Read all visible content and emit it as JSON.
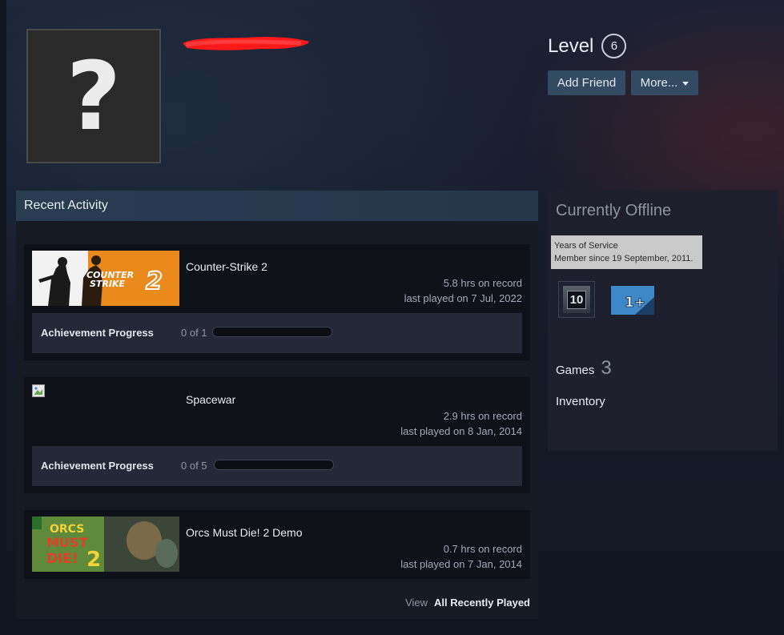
{
  "profile": {
    "avatar_placeholder": "?",
    "level_label": "Level",
    "level_value": "6",
    "add_friend_label": "Add Friend",
    "more_label": "More...",
    "colors": {
      "button": "#334a63",
      "redaction": "#ff0000"
    }
  },
  "recent_activity": {
    "title": "Recent Activity",
    "games": [
      {
        "name": "Counter-Strike 2",
        "capsule_text": [
          "COUNTER",
          "STRIKE"
        ],
        "hours": "5.8 hrs on record",
        "last_played": "last played on 7 Jul, 2022",
        "achievement_label": "Achievement Progress",
        "achievement_count": "0 of 1",
        "achievement_progress": 0
      },
      {
        "name": "Spacewar",
        "hours": "2.9 hrs on record",
        "last_played": "last played on 8 Jan, 2014",
        "achievement_label": "Achievement Progress",
        "achievement_count": "0 of 5",
        "achievement_progress": 0
      },
      {
        "name": "Orcs Must Die! 2 Demo",
        "capsule_text": [
          "ORCS",
          "MUST",
          "DIE!"
        ],
        "hours": "0.7 hrs on record",
        "last_played": "last played on 7 Jan, 2014"
      }
    ],
    "view_label": "View",
    "all_recently_played_label": "All Recently Played"
  },
  "sidebar": {
    "status": "Currently Offline",
    "tooltip_title": "Years of Service",
    "tooltip_text": "Member since 19 September, 2011.",
    "badge_years": "10",
    "badge_plus": "1+",
    "games_label": "Games",
    "games_count": "3",
    "inventory_label": "Inventory"
  }
}
